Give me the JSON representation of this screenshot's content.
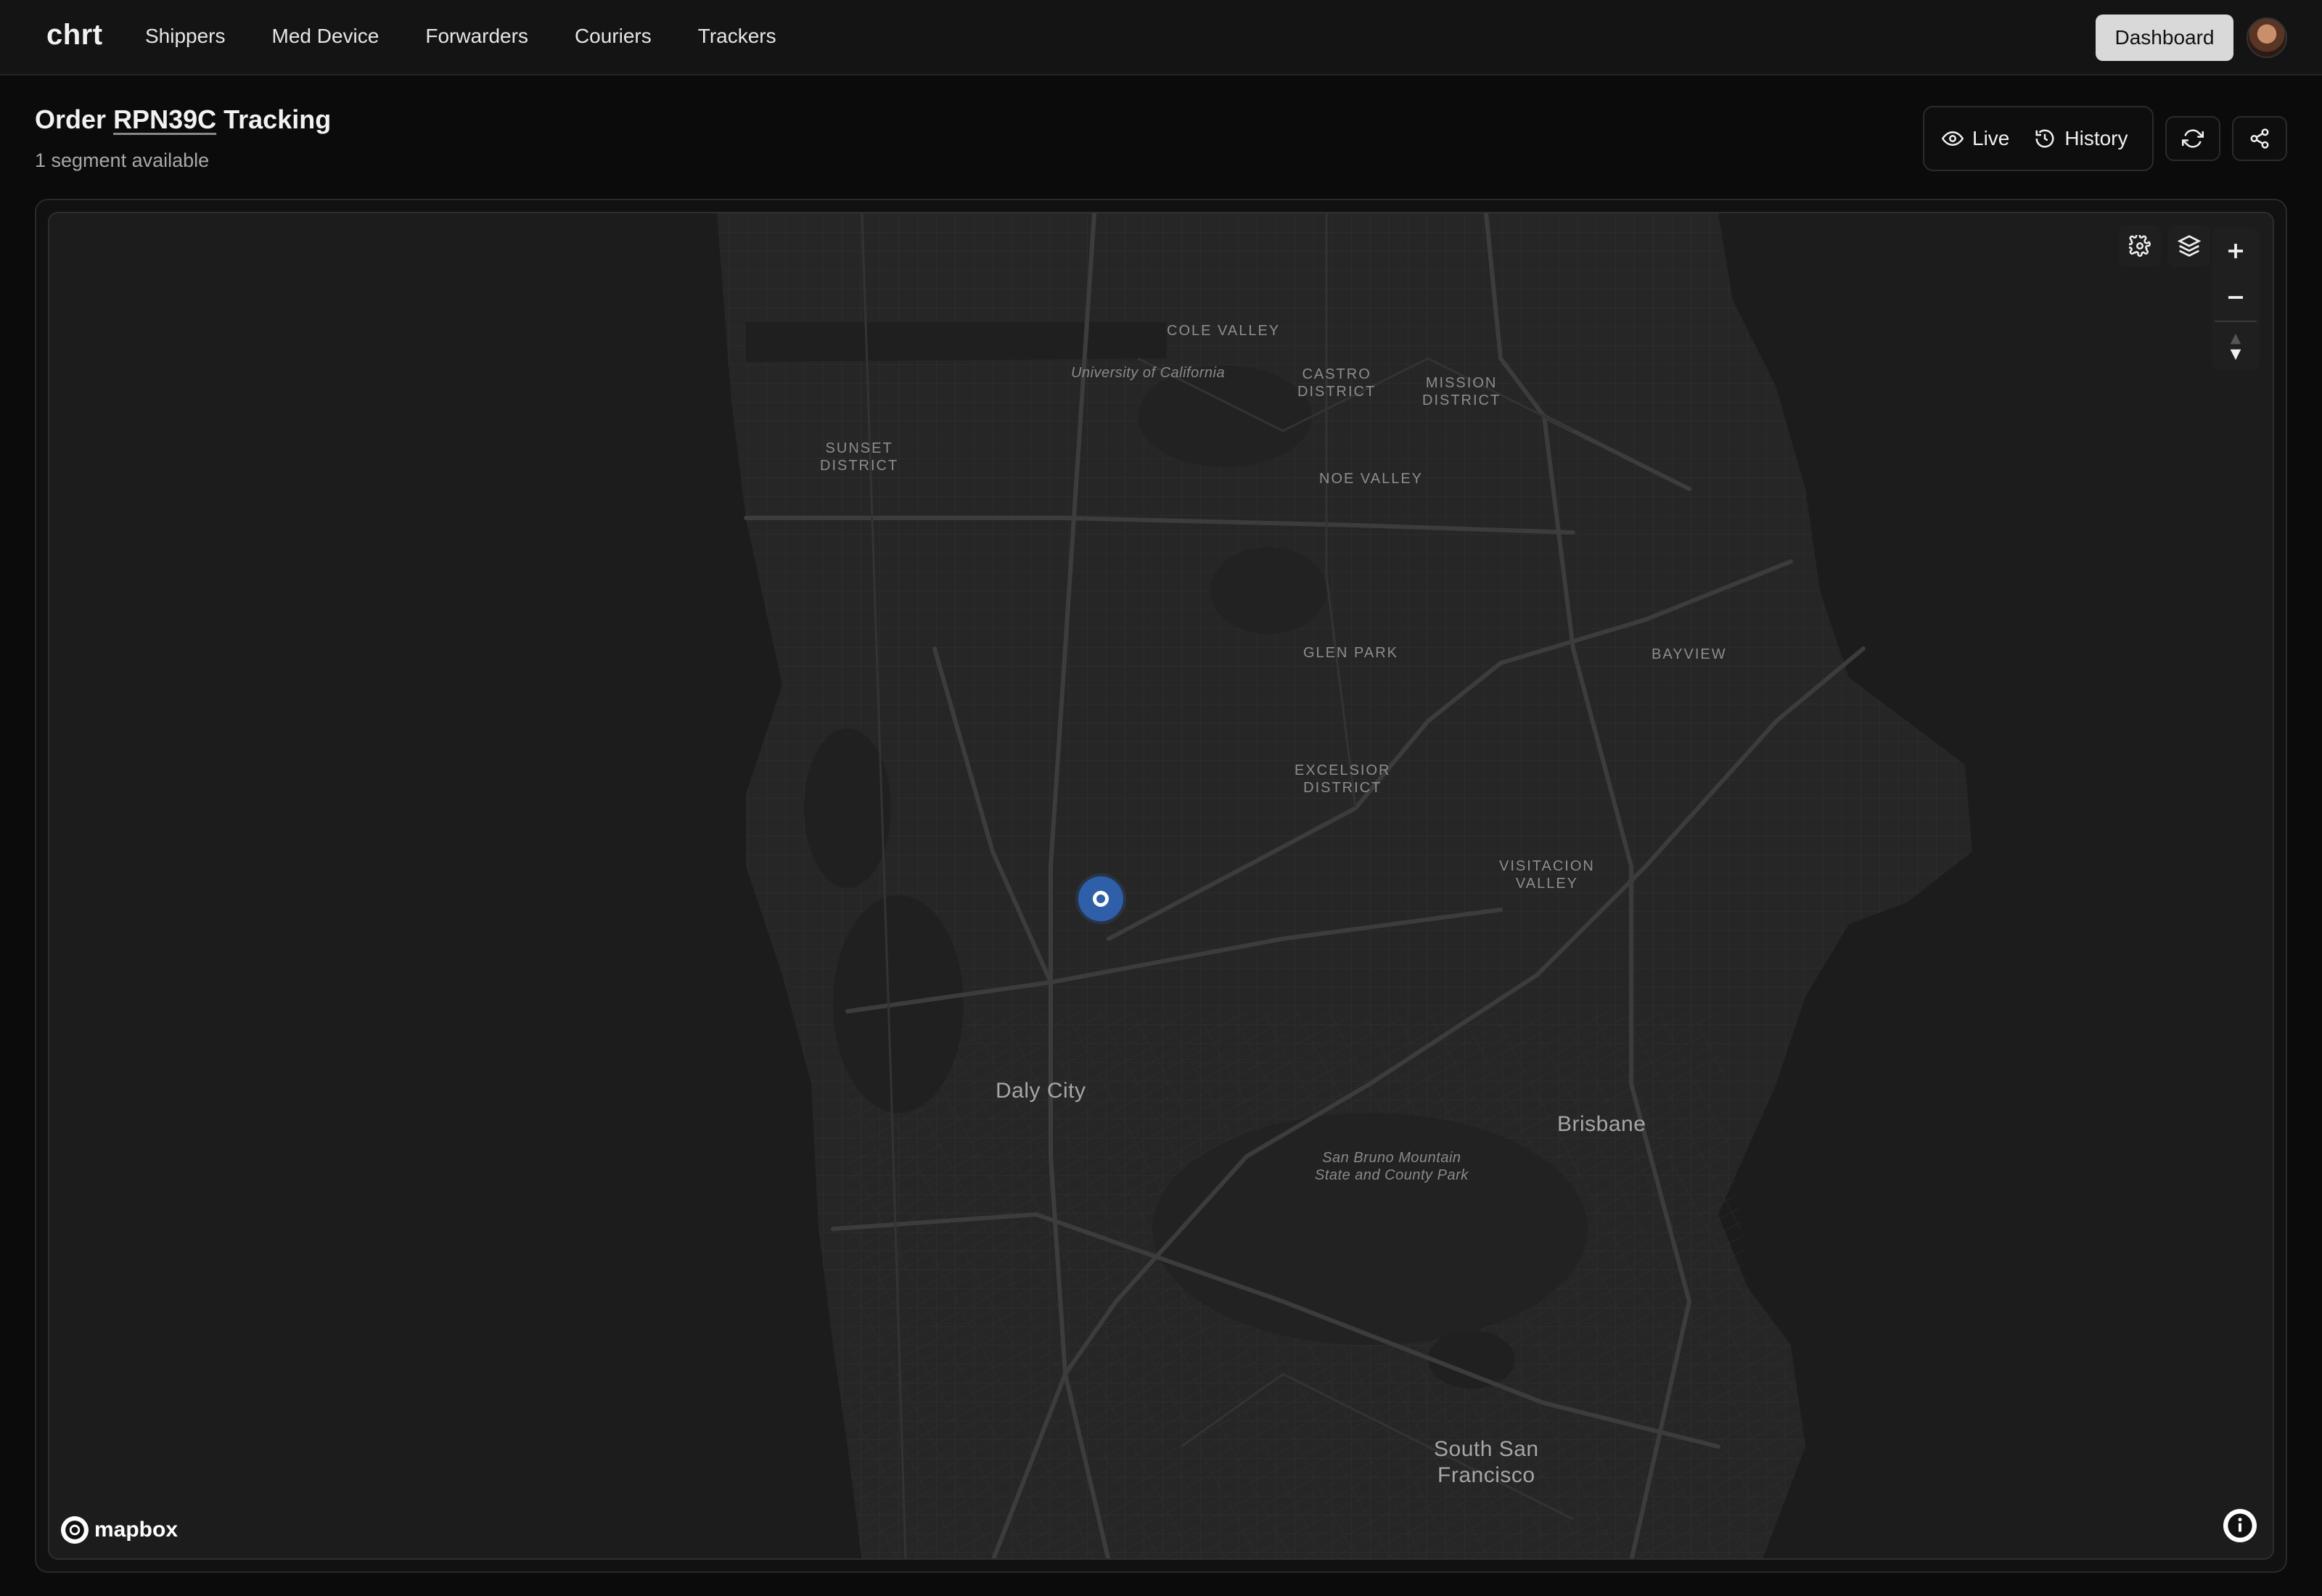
{
  "app": {
    "logo": "chrt"
  },
  "nav": {
    "items": [
      {
        "label": "Shippers"
      },
      {
        "label": "Med Device"
      },
      {
        "label": "Forwarders"
      },
      {
        "label": "Couriers"
      },
      {
        "label": "Trackers"
      }
    ],
    "dashboard_label": "Dashboard"
  },
  "header": {
    "title_prefix": "Order",
    "order_id": "RPN39C",
    "title_suffix": "Tracking",
    "subtitle": "1 segment available"
  },
  "view_modes": {
    "live_label": "Live",
    "history_label": "History"
  },
  "icons": {
    "live": "eye-icon",
    "history": "history-clock-icon",
    "refresh": "refresh-icon",
    "share": "share-icon",
    "settings": "gear-icon",
    "layers": "layers-icon",
    "zoom_in": "plus-icon",
    "zoom_out": "minus-icon",
    "compass": "compass-arrow-icon",
    "info": "info-icon"
  },
  "map": {
    "provider": "mapbox",
    "labels": {
      "cole_valley": "COLE VALLEY",
      "university": "University of California",
      "castro": "CASTRO\nDISTRICT",
      "mission": "MISSION\nDISTRICT",
      "sunset": "SUNSET\nDISTRICT",
      "noe_valley": "NOE VALLEY",
      "glen_park": "GLEN PARK",
      "bayview": "BAYVIEW",
      "excelsior": "EXCELSIOR\nDISTRICT",
      "visitacion": "VISITACION\nVALLEY",
      "daly_city": "Daly City",
      "brisbane": "Brisbane",
      "san_bruno": "San Bruno Mountain\nState and County Park",
      "south_sf": "South San\nFrancisco"
    }
  },
  "colors": {
    "marker": "#2f5fa8",
    "land": "#2a2a2a",
    "water": "#1c1c1c"
  }
}
